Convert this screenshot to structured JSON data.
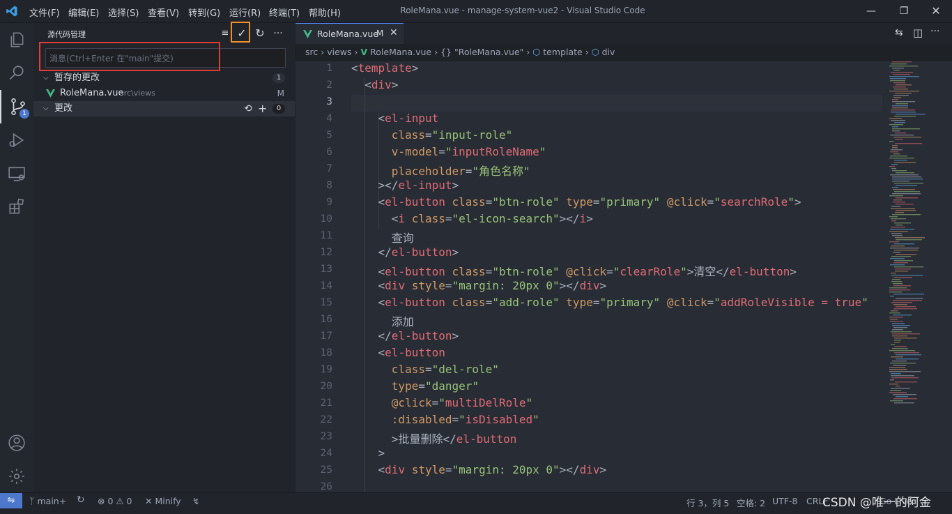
{
  "titlebar": {
    "menu": [
      "文件(F)",
      "编辑(E)",
      "选择(S)",
      "查看(V)",
      "转到(G)",
      "运行(R)",
      "终端(T)",
      "帮助(H)"
    ],
    "window_title": "RoleMana.vue - manage-system-vue2 - Visual Studio Code"
  },
  "activitybar": {
    "source_control_badge": "1"
  },
  "sidebar": {
    "title": "源代码管理",
    "message_placeholder": "消息(Ctrl+Enter 在\"main\"提交)",
    "staged": {
      "label": "暂存的更改",
      "count": "1"
    },
    "staged_file": {
      "name": "RoleMana.vue",
      "path": "src\\views",
      "status": "M"
    },
    "changes": {
      "label": "更改",
      "count": "0"
    }
  },
  "tab": {
    "name": "RoleMana.vue",
    "status": "M"
  },
  "breadcrumb": [
    "src",
    "views",
    "RoleMana.vue",
    "{} \"RoleMana.vue\"",
    "template",
    "div"
  ],
  "code": {
    "line_numbers": [
      "1",
      "2",
      "3",
      "4",
      "5",
      "6",
      "7",
      "8",
      "9",
      "10",
      "11",
      "12",
      "13",
      "14",
      "15",
      "16",
      "17",
      "18",
      "19",
      "20",
      "21",
      "22",
      "23",
      "24",
      "25",
      "26"
    ],
    "lines": [
      "<template>",
      "  <div>",
      "",
      "    <el-input",
      "      class=\"input-role\"",
      "      v-model=\"inputRoleName\"",
      "      placeholder=\"角色名称\"",
      "    ></el-input>",
      "    <el-button class=\"btn-role\" type=\"primary\" @click=\"searchRole\">",
      "      <i class=\"el-icon-search\"></i>",
      "      查询",
      "    </el-button>",
      "    <el-button class=\"btn-role\" @click=\"clearRole\">清空</el-button>",
      "    <div style=\"margin: 20px 0\"></div>",
      "    <el-button class=\"add-role\" type=\"primary\" @click=\"addRoleVisible = true\"",
      "      添加",
      "    </el-button>",
      "    <el-button",
      "      class=\"del-role\"",
      "      type=\"danger\"",
      "      @click=\"multiDelRole\"",
      "      :disabled=\"isDisabled\"",
      "      >批量删除</el-button",
      "    >",
      "    <div style=\"margin: 20px 0\"></div>",
      ""
    ]
  },
  "statusbar": {
    "branch": "main+",
    "problems": "⊗ 0 ⚠ 0",
    "minify": "Minify",
    "cursor": "行 3，列 5",
    "indent": "空格: 2",
    "encoding": "UTF-8",
    "eol": "CRLF",
    "golive": "Go Live"
  },
  "watermark": "CSDN @唯一的阿金",
  "colors": {
    "accent": "#4d78cc",
    "tag": "#e06c75",
    "attr": "#d19a66",
    "string": "#98c379",
    "highlight_orange": "#f0902a",
    "highlight_red": "#e33b36"
  }
}
